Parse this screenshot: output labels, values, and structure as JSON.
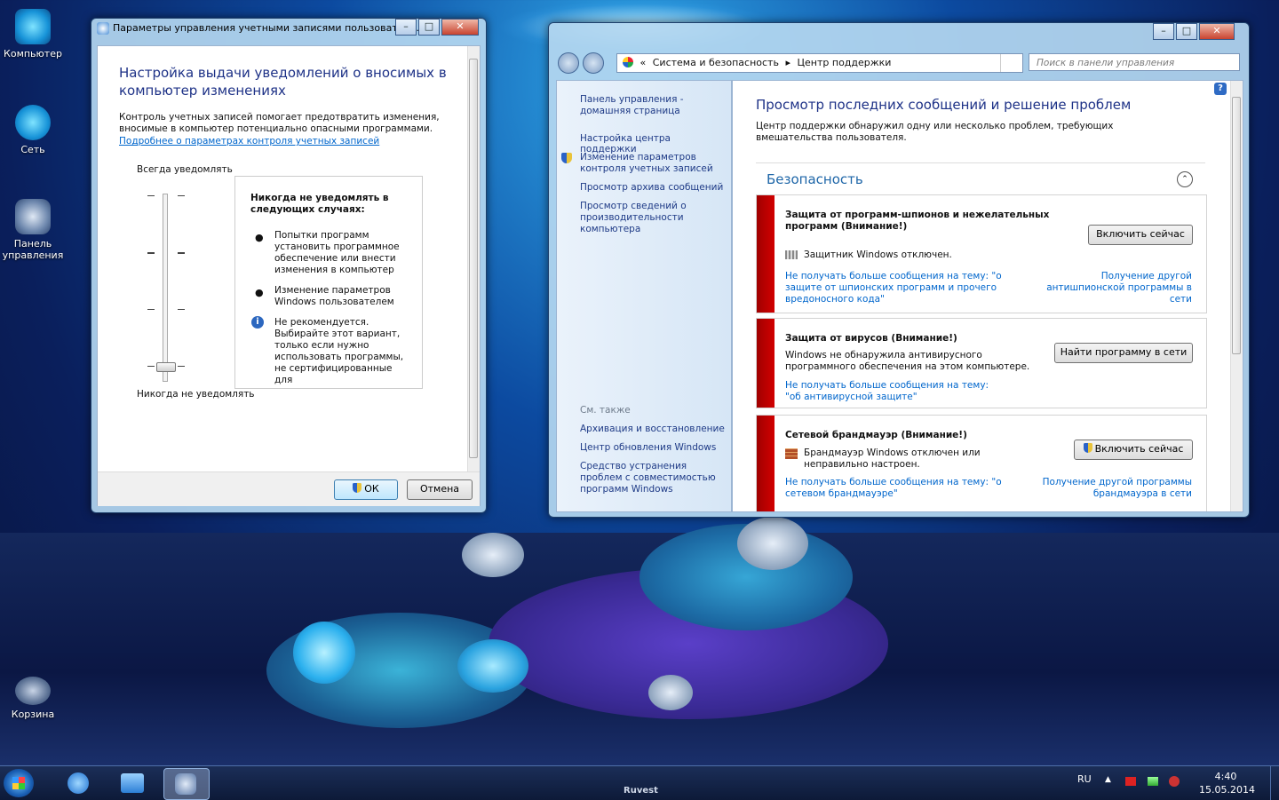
{
  "desktop": {
    "icons": [
      {
        "label": "Компьютер"
      },
      {
        "label": "Сеть"
      },
      {
        "label": "Панель управления"
      },
      {
        "label": "Корзина"
      }
    ]
  },
  "uac": {
    "title": "Параметры управления учетными записями пользовател...",
    "heading": "Настройка выдачи уведомлений о вносимых в компьютер изменениях",
    "description": "Контроль учетных записей помогает предотвратить изменения, вносимые в компьютер потенциально опасными программами.",
    "link": "Подробнее о параметрах контроля учетных записей",
    "slider_top": "Всегда уведомлять",
    "slider_bottom": "Никогда не уведомлять",
    "slider_level": "4 of 4 (bottom)",
    "panel_title": "Никогда не уведомлять в следующих случаях:",
    "bullets": [
      "Попытки программ установить программное обеспечение или внести изменения в компьютер",
      "Изменение параметров Windows пользователем"
    ],
    "warning": "Не рекомендуется. Выбирайте этот вариант, только если нужно использовать программы, не сертифицированные для",
    "ok": "ОК",
    "cancel": "Отмена"
  },
  "action_center": {
    "breadcrumb": [
      "«",
      "Система и безопасность",
      "Центр поддержки"
    ],
    "search_placeholder": "Поиск в панели управления",
    "sidebar": {
      "items": [
        "Панель управления - домашняя страница",
        "Настройка центра поддержки",
        "Изменение параметров контроля учетных записей",
        "Просмотр архива сообщений",
        "Просмотр сведений о производительности компьютера"
      ],
      "see_also_title": "См. также",
      "see_also": [
        "Архивация и восстановление",
        "Центр обновления Windows",
        "Средство устранения проблем с совместимостью программ Windows"
      ]
    },
    "main_title": "Просмотр последних сообщений и решение проблем",
    "main_desc": "Центр поддержки обнаружил одну или несколько проблем, требующих вмешательства пользователя.",
    "section_title": "Безопасность",
    "cards": [
      {
        "title": "Защита от программ-шпионов и нежелательных программ (Внимание!)",
        "status": "Защитник Windows отключен.",
        "button": "Включить сейчас",
        "link_left": "Не получать больше сообщения на тему: \"о защите от шпионских программ и прочего вредоносного кода\"",
        "link_right": "Получение другой антишпионской программы в сети"
      },
      {
        "title": "Защита от вирусов (Внимание!)",
        "status": "Windows не обнаружила антивирусного программного обеспечения на этом компьютере.",
        "button": "Найти программу в сети",
        "link_left": "Не получать больше сообщения на тему: \"об антивирусной защите\"",
        "link_right": ""
      },
      {
        "title": "Сетевой брандмауэр (Внимание!)",
        "status": "Брандмауэр Windows отключен или неправильно настроен.",
        "button": "Включить сейчас",
        "link_left": "Не получать больше сообщения на тему: \"о сетевом брандмауэре\"",
        "link_right": "Получение другой программы брандмауэра в сети"
      }
    ]
  },
  "taskbar": {
    "lang": "RU",
    "time": "4:40",
    "date": "15.05.2014",
    "center_text": "Ruvest"
  }
}
